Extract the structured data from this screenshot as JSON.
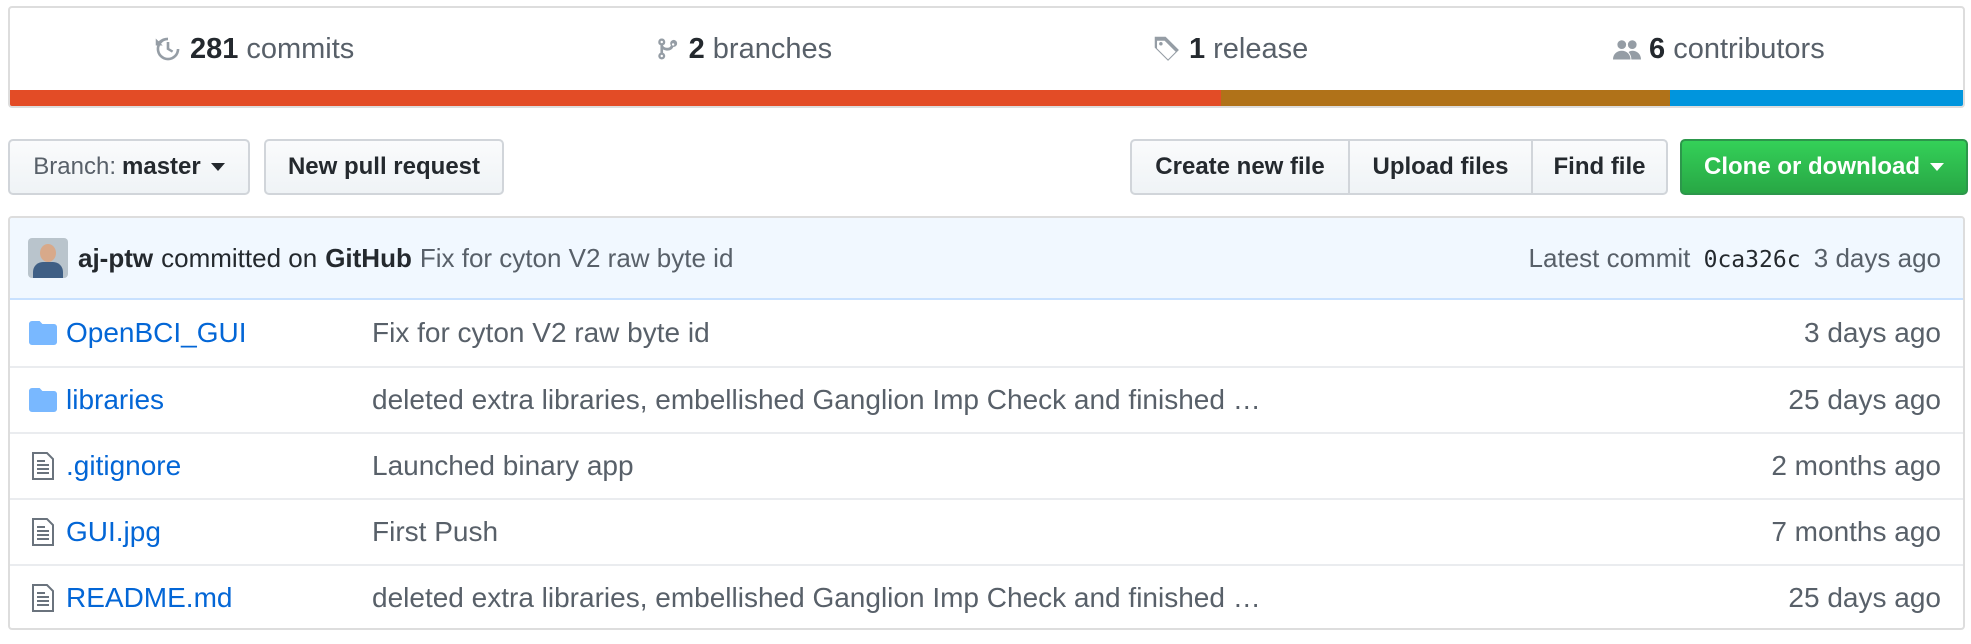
{
  "summary": {
    "commits": {
      "count": "281",
      "label": "commits",
      "icon": "history-icon"
    },
    "branches": {
      "count": "2",
      "label": "branches",
      "icon": "git-branch-icon"
    },
    "releases": {
      "count": "1",
      "label": "release",
      "icon": "tag-icon"
    },
    "contributors": {
      "count": "6",
      "label": "contributors",
      "icon": "people-icon"
    }
  },
  "languages": [
    {
      "color": "#e34c26",
      "fraction": 0.62
    },
    {
      "color": "#b07219",
      "fraction": 0.23
    },
    {
      "color": "#0095dd",
      "fraction": 0.15
    }
  ],
  "toolbar": {
    "branch_prefix": "Branch:",
    "branch_name": "master",
    "new_pr": "New pull request",
    "create_file": "Create new file",
    "upload_files": "Upload files",
    "find_file": "Find file",
    "clone": "Clone or download"
  },
  "latest_commit": {
    "author": "aj-ptw",
    "committed_on": "committed on",
    "platform": "GitHub",
    "message": "Fix for cyton V2 raw byte id",
    "latest_label": "Latest commit",
    "sha": "0ca326c",
    "age": "3 days ago"
  },
  "files": [
    {
      "type": "folder",
      "icon": "folder-icon",
      "name": "OpenBCI_GUI",
      "message": "Fix for cyton V2 raw byte id",
      "age": "3 days ago"
    },
    {
      "type": "folder",
      "icon": "folder-icon",
      "name": "libraries",
      "message": "deleted extra libraries, embellished Ganglion Imp Check and finished …",
      "age": "25 days ago"
    },
    {
      "type": "file",
      "icon": "file-icon",
      "name": ".gitignore",
      "message": "Launched binary app",
      "age": "2 months ago"
    },
    {
      "type": "file",
      "icon": "file-icon",
      "name": "GUI.jpg",
      "message": "First Push",
      "age": "7 months ago"
    },
    {
      "type": "file",
      "icon": "file-icon",
      "name": "README.md",
      "message": "deleted extra libraries, embellished Ganglion Imp Check and finished …",
      "age": "25 days ago"
    }
  ]
}
